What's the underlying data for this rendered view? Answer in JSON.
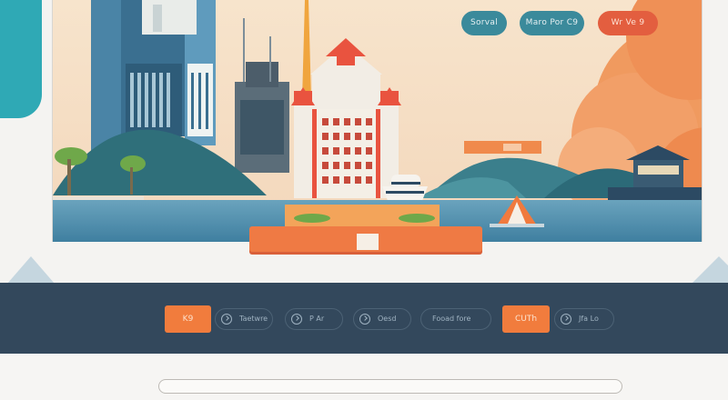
{
  "header": {
    "buttons": [
      {
        "label": "Sorval"
      },
      {
        "label": "Maro Por C9"
      },
      {
        "label": "Wr Ve 9"
      }
    ]
  },
  "nav": {
    "buttons": [
      {
        "label": "K9",
        "style": "orange"
      },
      {
        "label": "Taetwre",
        "icon": "chevron-circle-icon"
      },
      {
        "label": "P Ar",
        "icon": "chevron-circle-icon"
      },
      {
        "label": "Oesd",
        "icon": "chevron-circle-icon"
      },
      {
        "label": "Fooad fore",
        "icon": ""
      },
      {
        "label": "CUTh",
        "style": "orange"
      },
      {
        "label": "Jfa Lo",
        "icon": "chevron-circle-icon"
      }
    ]
  },
  "search": {
    "placeholder": ""
  },
  "colors": {
    "accent_teal": "#2fa9b5",
    "accent_orange": "#f17c3d",
    "nav_background": "#33485c",
    "sky": "#f6e3cb"
  }
}
